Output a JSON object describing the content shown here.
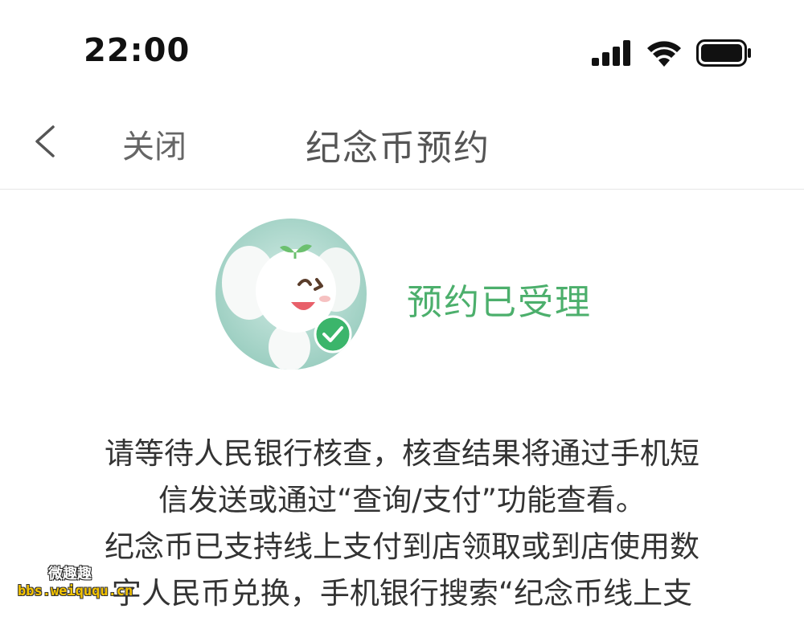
{
  "status_bar": {
    "time": "22:00",
    "icons": [
      "cellular-signal-icon",
      "wifi-icon",
      "battery-icon"
    ]
  },
  "nav": {
    "back_icon": "chevron-left-icon",
    "close_label": "关闭",
    "title": "纪念币预约"
  },
  "result": {
    "mascot": "elephant-mascot-with-check",
    "status": "预约已受理",
    "message_lines": [
      "请等待人民银行核查，核查结果将通过手机短",
      "信发送或通过“查询/支付”功能查看。",
      "纪念币已支持线上支付到店领取或到店使用数",
      "字人民币兑换，手机银行搜索“纪念币线上支"
    ]
  },
  "watermark": {
    "title": "微趣趣",
    "url": "bbs.weiququ.cn"
  },
  "colors": {
    "status_green": "#4caf6c",
    "check_green": "#3bb56b",
    "avatar_bg": "#9fd0c3",
    "title_gray": "#555555",
    "text": "#333333"
  }
}
